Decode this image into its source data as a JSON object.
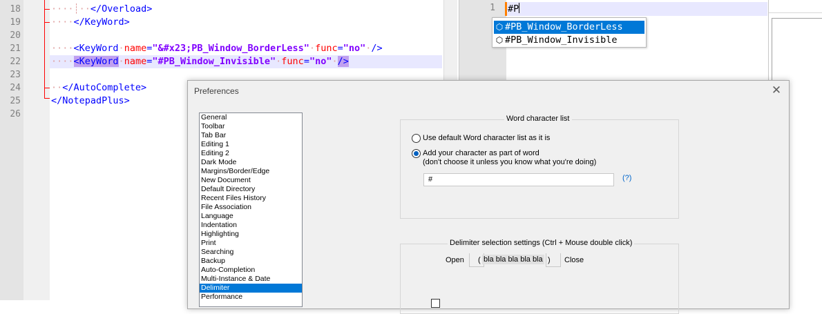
{
  "left_editor": {
    "line_numbers": [
      "18",
      "19",
      "20",
      "21",
      "22",
      "23",
      "24",
      "25",
      "26"
    ],
    "lines": {
      "l18": "</Overload>",
      "l19": "</KeyWord>",
      "l21": {
        "open": "<KeyWord",
        "name_attr": "name",
        "eq1": "=",
        "name_val": "\"&#x23;PB_Window_BorderLess\"",
        "func_attr": "func",
        "eq2": "=",
        "func_val": "\"no\"",
        "close": "/>"
      },
      "l22": {
        "open": "<KeyWord",
        "name_attr": "name",
        "eq1": "=",
        "name_val": "\"#PB_Window_Invisible\"",
        "func_attr": "func",
        "eq2": "=",
        "func_val": "\"no\"",
        "close": "/>"
      },
      "l24": "</AutoComplete>",
      "l25": "</NotepadPlus>"
    }
  },
  "right_editor": {
    "line_number": "1",
    "text": "#P"
  },
  "autocomplete": {
    "items": [
      {
        "label": "#PB_Window_BorderLess",
        "icon": "cube-icon"
      },
      {
        "label": "#PB_Window_Invisible",
        "icon": "cube-icon"
      }
    ]
  },
  "preferences": {
    "title": "Preferences",
    "categories": [
      "General",
      "Toolbar",
      "Tab Bar",
      "Editing 1",
      "Editing 2",
      "Dark Mode",
      "Margins/Border/Edge",
      "New Document",
      "Default Directory",
      "Recent Files History",
      "File Association",
      "Language",
      "Indentation",
      "Highlighting",
      "Print",
      "Searching",
      "Backup",
      "Auto-Completion",
      "Multi-Instance & Date",
      "Delimiter",
      "Performance"
    ],
    "selected_category": "Delimiter",
    "word_char": {
      "group_title": "Word character list",
      "option_default": "Use default Word character list as it is",
      "option_custom": "Add your character as part of word",
      "option_custom_note": "(don't choose it unless you know what you're doing)",
      "input_value": "#",
      "help": "(?)"
    },
    "delimiter": {
      "group_title": "Delimiter selection settings (Ctrl + Mouse double click)",
      "open_label": "Open",
      "open_value": "(",
      "sample": "bla bla bla bla bla",
      "close_value": ")",
      "close_label": "Close"
    }
  }
}
